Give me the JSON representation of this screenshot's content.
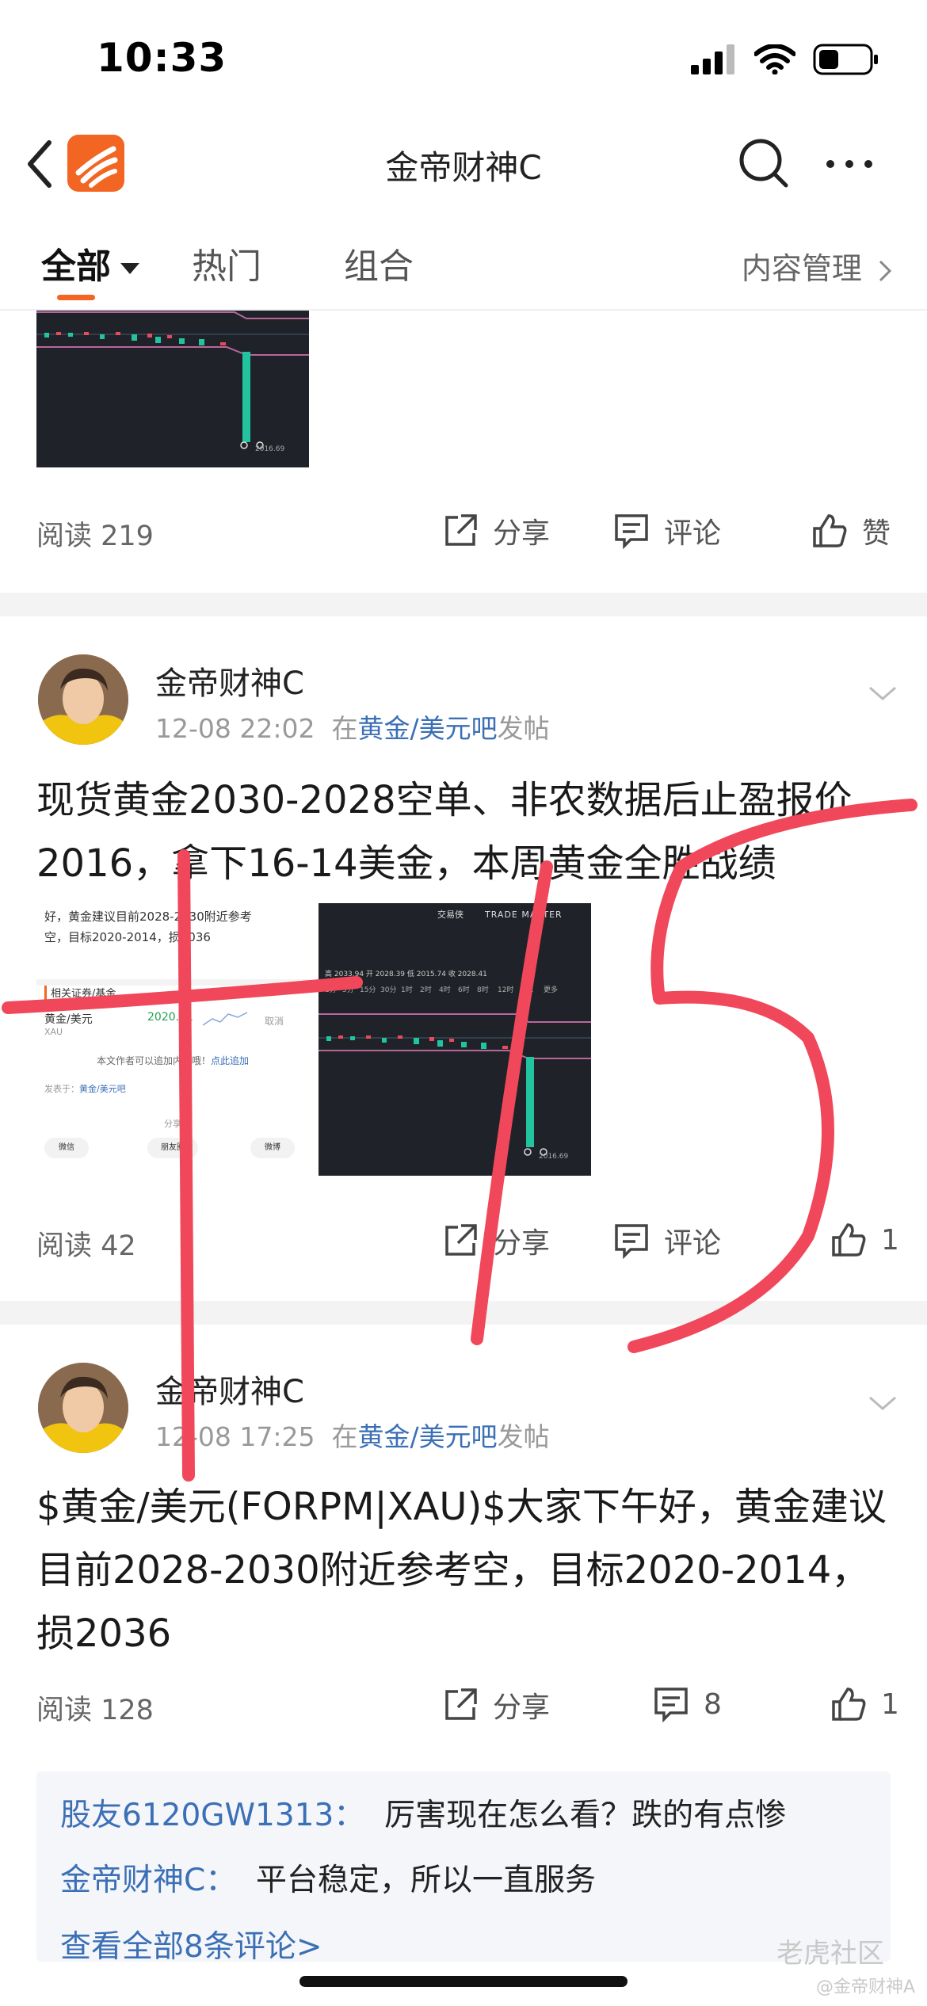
{
  "status": {
    "time": "10:33"
  },
  "nav": {
    "title": "金帝财神C"
  },
  "tabs": [
    {
      "label": "全部",
      "active": true
    },
    {
      "label": "热门",
      "active": false
    },
    {
      "label": "组合",
      "active": false
    }
  ],
  "manage_label": "内容管理",
  "actions": {
    "share": "分享",
    "comment": "评论",
    "like": "赞"
  },
  "post1": {
    "reads": "阅读 219"
  },
  "post2": {
    "author": "金帝财神C",
    "time": "12-08 22:02",
    "in": "在",
    "forum": "黄金/美元吧",
    "suffix": "发帖",
    "text": "现货黄金2030-2028空单、非农数据后止盈报价2016，拿下16-14美金，本周黄金全胜战绩",
    "reads": "阅读 42",
    "likes": "1",
    "doc_thumb": {
      "line1": "好，黄金建议目前2028-2030附近参考",
      "line2": "空，目标2020-2014，损2036",
      "section": "相关证券/基金",
      "asset": "黄金/美元",
      "asset_code": "XAU",
      "price": "2020.91",
      "cancel": "取消",
      "note": "本文作者可以追加内容哦！",
      "note_link": "点此追加",
      "posted_in": "发表于：",
      "posted_forum": "黄金/美元吧",
      "share_title": "分享",
      "share_wechat": "微信",
      "share_moments": "朋友圈",
      "share_weibo": "微博"
    },
    "chart_thumb": {
      "app_name": "交易侠",
      "brand": "TRADE MASTER",
      "ohlc": "高 2033.94  开 2028.39  低 2015.74  收 2028.41",
      "timeframes": [
        "1分",
        "5分",
        "15分",
        "30分",
        "1时",
        "2时",
        "4时",
        "6时",
        "8时",
        "12时",
        "月K",
        "更多"
      ],
      "last_price": "2016.69"
    }
  },
  "post3": {
    "author": "金帝财神C",
    "time": "12-08 17:25",
    "in": "在",
    "forum": "黄金/美元吧",
    "suffix": "发帖",
    "text": "$黄金/美元(FORPM|XAU)$大家下午好，黄金建议目前2028-2030附近参考空，目标2020-2014，损2036",
    "reads": "阅读 128",
    "comments": "8",
    "likes": "1"
  },
  "comments": [
    {
      "name": "股友6120GW1313：",
      "text": "厉害现在怎么看？跌的有点惨"
    },
    {
      "name": "金帝财神C：",
      "text": "平台稳定，所以一直服务"
    }
  ],
  "view_all": "查看全部8条评论>",
  "watermark": {
    "main": "老虎社区",
    "sub": "@金帝财神A"
  },
  "top_chart": {
    "last_price": "2016.69"
  },
  "colors": {
    "accent": "#f26522",
    "link": "#3b6fb6",
    "scribble": "#f0485a",
    "chart_bg": "#1f2329",
    "candle_down": "#22c4a0",
    "candle_up": "#e84b5a"
  }
}
